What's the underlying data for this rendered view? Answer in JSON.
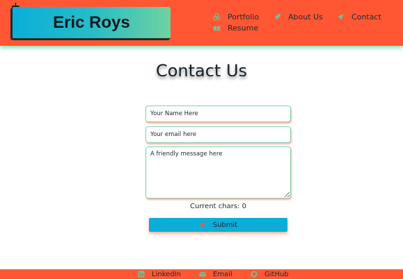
{
  "header": {
    "logo_text": "Eric Roys",
    "corner_icon": "robot-icon",
    "nav": {
      "portfolio": {
        "label": "Portfolio",
        "icon": "biohazard-icon"
      },
      "about": {
        "label": "About Us",
        "icon": "rocket-icon"
      },
      "contact": {
        "label": "Contact",
        "icon": "paper-plane-icon"
      },
      "resume": {
        "label": "Resume",
        "icon": "book-open-icon"
      }
    }
  },
  "main": {
    "title": "Contact Us",
    "form": {
      "name_placeholder": "Your Name Here",
      "name_value": "",
      "email_placeholder": "Your email here",
      "email_value": "",
      "message_placeholder": "A friendly message here",
      "message_value": "",
      "char_count": "Current chars: 0",
      "submit_label": "Submit",
      "submit_icon": "paper-plane-icon"
    }
  },
  "footer": {
    "links": {
      "linkedin": {
        "label": "LinkedIn",
        "icon": "linkedin-icon"
      },
      "email": {
        "label": "Email",
        "icon": "envelope-icon"
      },
      "github": {
        "label": "GitHub",
        "icon": "github-icon"
      }
    }
  },
  "colors": {
    "primary": "#ff5733",
    "accent_blue": "#0aaed8",
    "accent_green": "#6fd2a0",
    "text": "#1c2a33"
  }
}
